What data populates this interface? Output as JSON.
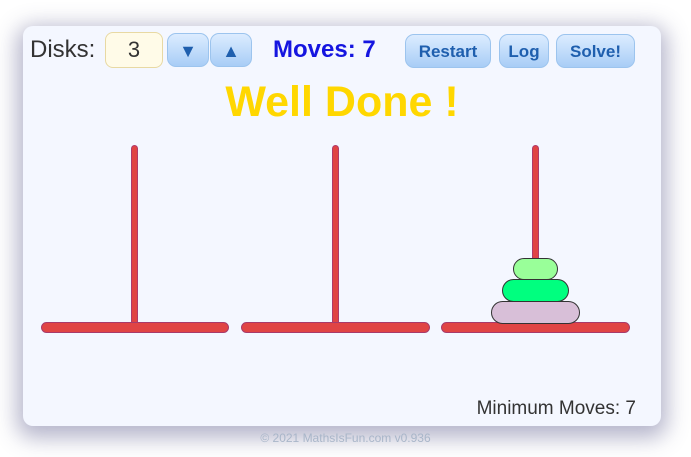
{
  "controls": {
    "disks_label": "Disks:",
    "disks_value": "3",
    "down_arrow": "▼",
    "up_arrow": "▲",
    "moves_label": "Moves: 7",
    "restart_label": "Restart",
    "log_label": "Log",
    "solve_label": "Solve!"
  },
  "message": "Well Done !",
  "game": {
    "pegs": 3,
    "disks": [
      {
        "peg": 3,
        "size": "small",
        "color": "#99ff99"
      },
      {
        "peg": 3,
        "size": "medium",
        "color": "#00ff7f"
      },
      {
        "peg": 3,
        "size": "large",
        "color": "#d8bfd8"
      }
    ]
  },
  "status": {
    "minimum_moves": "Minimum Moves: 7"
  },
  "footer": "© 2021 MathsIsFun.com v0.936",
  "colors": {
    "pole": "#e04444",
    "moves_text": "#1515e0",
    "message_text": "#ffd700"
  }
}
